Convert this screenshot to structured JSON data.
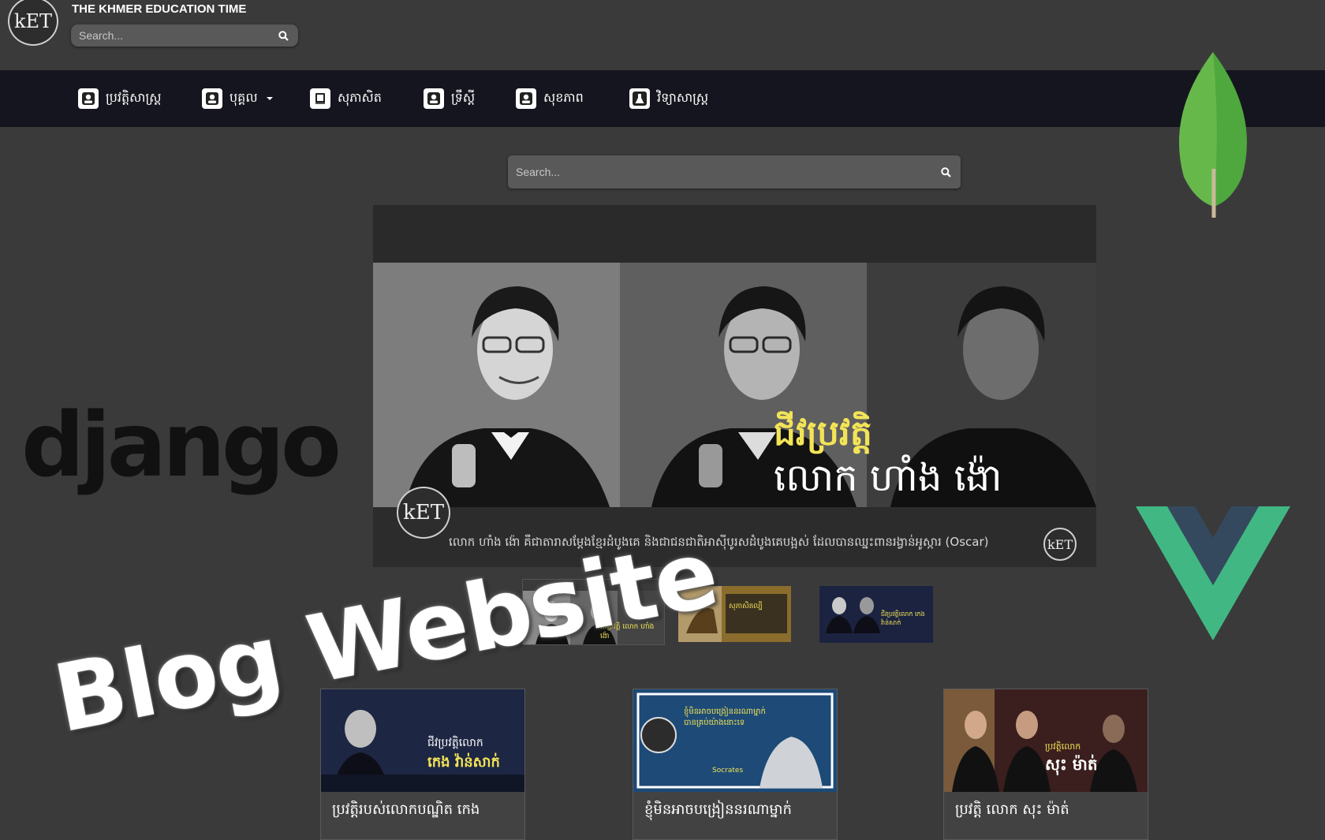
{
  "header": {
    "logo_text": "kET",
    "site_title": "THE KHMER EDUCATION TIME",
    "search_placeholder": "Search..."
  },
  "nav": {
    "items": [
      {
        "label": "ប្រវត្តិសាស្ត្រ",
        "icon": "person-icon"
      },
      {
        "label": "បុគ្គល",
        "icon": "person-icon",
        "dropdown": true
      },
      {
        "label": "សុភាសិត",
        "icon": "book-icon"
      },
      {
        "label": "ទ្រឹស្តី",
        "icon": "person-icon"
      },
      {
        "label": "សុខភាព",
        "icon": "person-icon"
      },
      {
        "label": "វិទ្យាសាស្ត្រ",
        "icon": "flask-icon"
      }
    ]
  },
  "main_search": {
    "placeholder": "Search..."
  },
  "carousel": {
    "title_line1": "ជីវប្រវត្តិ",
    "title_line2": "លោក ហាំង ង៉ោ",
    "caption": "លោក ហាំង ង៉ោ គឺជាតារាសម្តែងខ្មែរដំបូងគេ និងជាជនជាតិអាស៊ីបូរសដំបូងគេបង្អស់ ដែលបានឈ្នះពានរង្វាន់អូស្ការ (Oscar)",
    "logo_text": "kET",
    "thumbnails": [
      {
        "label": "ជីវប្រវត្តិ លោក ហាំង ង៉ោ"
      },
      {
        "label": "សុភាសិតល្បី"
      },
      {
        "label": "ជីវប្រវត្តិលោក កេង វ៉ាន់សាក់"
      }
    ]
  },
  "cards": [
    {
      "title": "ប្រវត្តិរបស់លោកបណ្ឌិត កេង",
      "image_text_1": "ជីវប្រវត្តិលោក",
      "image_text_2": "កេង វ៉ាន់សាក់"
    },
    {
      "title": "ខ្ញុំមិនអាចបង្រៀននរណាម្នាក់",
      "image_text_1": "ខ្ញុំមិនអាចបង្រៀននរណាម្នាក់ បានគ្រប់យ៉ាងនោះទេ",
      "image_text_2": "Socrates"
    },
    {
      "title": "ប្រវត្តិ លោក សុះ ម៉ាត់",
      "image_text_1": "ប្រវត្តិលោក",
      "image_text_2": "សុះ ម៉ាត់"
    }
  ],
  "overlay": {
    "django_text": "django",
    "banner_text": "Blog Website"
  },
  "colors": {
    "background": "#3a3a3b",
    "navbar": "#15151f",
    "accent_yellow": "#f3e457",
    "vue_green": "#41b883",
    "vue_dark": "#35495e",
    "mongo_green": "#4fa83d"
  }
}
